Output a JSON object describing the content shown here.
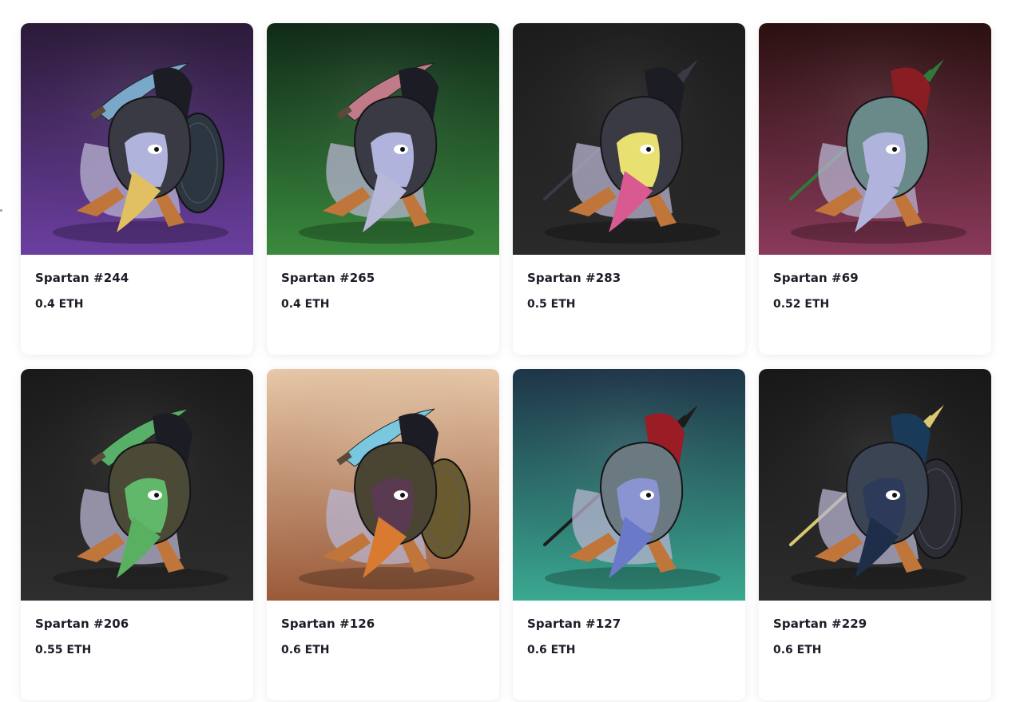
{
  "cards": [
    {
      "name": "Spartan #244",
      "price": "0.4 ETH",
      "bg_top": "#2b1a38",
      "bg_bottom": "#6b3fa0",
      "helmet": "#3a3a44",
      "crest": "#1c1c24",
      "beard": "#e0c060",
      "face": "#b0b4dc",
      "weapon": "#7aa8c8",
      "weapon_type": "sword",
      "shield": true,
      "shield_color": "#2c3640"
    },
    {
      "name": "Spartan #265",
      "price": "0.4 ETH",
      "bg_top": "#102a18",
      "bg_bottom": "#3a8a3e",
      "helmet": "#3a3a44",
      "crest": "#1c1c24",
      "beard": "#b8b8d8",
      "face": "#b0b4dc",
      "weapon": "#c07a88",
      "weapon_type": "sword",
      "shield": false,
      "shield_color": "#2c3640"
    },
    {
      "name": "Spartan #283",
      "price": "0.5 ETH",
      "bg_top": "#1c1c1c",
      "bg_bottom": "#2a2a2a",
      "helmet": "#3a3a44",
      "crest": "#1c1c24",
      "beard": "#d85a90",
      "face": "#e8e070",
      "weapon": "#3a3a46",
      "weapon_type": "spear",
      "shield": false,
      "shield_color": "#2c3640"
    },
    {
      "name": "Spartan #69",
      "price": "0.52 ETH",
      "bg_top": "#2a1010",
      "bg_bottom": "#8a3a5a",
      "helmet": "#6a8a8a",
      "crest": "#8a1c24",
      "beard": "#b0b4dc",
      "face": "#b0b4dc",
      "weapon": "#2e7a3a",
      "weapon_type": "spear",
      "shield": false,
      "shield_color": "#2c3640"
    },
    {
      "name": "Spartan #206",
      "price": "0.55 ETH",
      "bg_top": "#1a1a1a",
      "bg_bottom": "#2e2e2e",
      "helmet": "#4a4a36",
      "crest": "#1c1c24",
      "beard": "#58b060",
      "face": "#62b86a",
      "weapon": "#58b068",
      "weapon_type": "sword",
      "shield": false,
      "shield_color": "#2c3640"
    },
    {
      "name": "Spartan #126",
      "price": "0.6 ETH",
      "bg_top": "#e8c8a8",
      "bg_bottom": "#9a5a3a",
      "helmet": "#4a4432",
      "crest": "#1c1c24",
      "beard": "#d87a30",
      "face": "#5a3a50",
      "weapon": "#7ac8e0",
      "weapon_type": "sword",
      "shield": true,
      "shield_color": "#6a5a30"
    },
    {
      "name": "Spartan #127",
      "price": "0.6 ETH",
      "bg_top": "#1e3548",
      "bg_bottom": "#3aa890",
      "helmet": "#6a7a80",
      "crest": "#9a1c24",
      "beard": "#6a7ac8",
      "face": "#8a94d0",
      "weapon": "#1c1c1c",
      "weapon_type": "spear",
      "shield": false,
      "shield_color": "#2c3640"
    },
    {
      "name": "Spartan #229",
      "price": "0.6 ETH",
      "bg_top": "#181818",
      "bg_bottom": "#2c2c2c",
      "helmet": "#3a4452",
      "crest": "#1a3a5a",
      "beard": "#1e2e4a",
      "face": "#2e3a5a",
      "weapon": "#d8c870",
      "weapon_type": "spear",
      "shield": true,
      "shield_color": "#2c2c34"
    }
  ]
}
